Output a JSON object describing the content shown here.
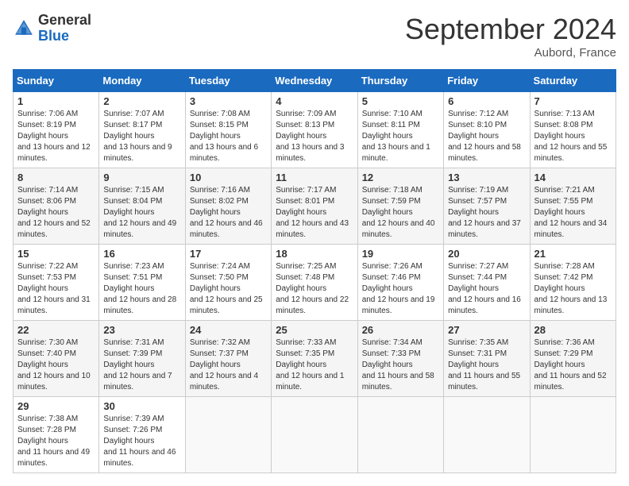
{
  "header": {
    "logo_general": "General",
    "logo_blue": "Blue",
    "month_title": "September 2024",
    "location": "Aubord, France"
  },
  "days_of_week": [
    "Sunday",
    "Monday",
    "Tuesday",
    "Wednesday",
    "Thursday",
    "Friday",
    "Saturday"
  ],
  "weeks": [
    [
      {
        "day": "1",
        "sunrise": "7:06 AM",
        "sunset": "8:19 PM",
        "daylight": "13 hours and 12 minutes."
      },
      {
        "day": "2",
        "sunrise": "7:07 AM",
        "sunset": "8:17 PM",
        "daylight": "13 hours and 9 minutes."
      },
      {
        "day": "3",
        "sunrise": "7:08 AM",
        "sunset": "8:15 PM",
        "daylight": "13 hours and 6 minutes."
      },
      {
        "day": "4",
        "sunrise": "7:09 AM",
        "sunset": "8:13 PM",
        "daylight": "13 hours and 3 minutes."
      },
      {
        "day": "5",
        "sunrise": "7:10 AM",
        "sunset": "8:11 PM",
        "daylight": "13 hours and 1 minute."
      },
      {
        "day": "6",
        "sunrise": "7:12 AM",
        "sunset": "8:10 PM",
        "daylight": "12 hours and 58 minutes."
      },
      {
        "day": "7",
        "sunrise": "7:13 AM",
        "sunset": "8:08 PM",
        "daylight": "12 hours and 55 minutes."
      }
    ],
    [
      {
        "day": "8",
        "sunrise": "7:14 AM",
        "sunset": "8:06 PM",
        "daylight": "12 hours and 52 minutes."
      },
      {
        "day": "9",
        "sunrise": "7:15 AM",
        "sunset": "8:04 PM",
        "daylight": "12 hours and 49 minutes."
      },
      {
        "day": "10",
        "sunrise": "7:16 AM",
        "sunset": "8:02 PM",
        "daylight": "12 hours and 46 minutes."
      },
      {
        "day": "11",
        "sunrise": "7:17 AM",
        "sunset": "8:01 PM",
        "daylight": "12 hours and 43 minutes."
      },
      {
        "day": "12",
        "sunrise": "7:18 AM",
        "sunset": "7:59 PM",
        "daylight": "12 hours and 40 minutes."
      },
      {
        "day": "13",
        "sunrise": "7:19 AM",
        "sunset": "7:57 PM",
        "daylight": "12 hours and 37 minutes."
      },
      {
        "day": "14",
        "sunrise": "7:21 AM",
        "sunset": "7:55 PM",
        "daylight": "12 hours and 34 minutes."
      }
    ],
    [
      {
        "day": "15",
        "sunrise": "7:22 AM",
        "sunset": "7:53 PM",
        "daylight": "12 hours and 31 minutes."
      },
      {
        "day": "16",
        "sunrise": "7:23 AM",
        "sunset": "7:51 PM",
        "daylight": "12 hours and 28 minutes."
      },
      {
        "day": "17",
        "sunrise": "7:24 AM",
        "sunset": "7:50 PM",
        "daylight": "12 hours and 25 minutes."
      },
      {
        "day": "18",
        "sunrise": "7:25 AM",
        "sunset": "7:48 PM",
        "daylight": "12 hours and 22 minutes."
      },
      {
        "day": "19",
        "sunrise": "7:26 AM",
        "sunset": "7:46 PM",
        "daylight": "12 hours and 19 minutes."
      },
      {
        "day": "20",
        "sunrise": "7:27 AM",
        "sunset": "7:44 PM",
        "daylight": "12 hours and 16 minutes."
      },
      {
        "day": "21",
        "sunrise": "7:28 AM",
        "sunset": "7:42 PM",
        "daylight": "12 hours and 13 minutes."
      }
    ],
    [
      {
        "day": "22",
        "sunrise": "7:30 AM",
        "sunset": "7:40 PM",
        "daylight": "12 hours and 10 minutes."
      },
      {
        "day": "23",
        "sunrise": "7:31 AM",
        "sunset": "7:39 PM",
        "daylight": "12 hours and 7 minutes."
      },
      {
        "day": "24",
        "sunrise": "7:32 AM",
        "sunset": "7:37 PM",
        "daylight": "12 hours and 4 minutes."
      },
      {
        "day": "25",
        "sunrise": "7:33 AM",
        "sunset": "7:35 PM",
        "daylight": "12 hours and 1 minute."
      },
      {
        "day": "26",
        "sunrise": "7:34 AM",
        "sunset": "7:33 PM",
        "daylight": "11 hours and 58 minutes."
      },
      {
        "day": "27",
        "sunrise": "7:35 AM",
        "sunset": "7:31 PM",
        "daylight": "11 hours and 55 minutes."
      },
      {
        "day": "28",
        "sunrise": "7:36 AM",
        "sunset": "7:29 PM",
        "daylight": "11 hours and 52 minutes."
      }
    ],
    [
      {
        "day": "29",
        "sunrise": "7:38 AM",
        "sunset": "7:28 PM",
        "daylight": "11 hours and 49 minutes."
      },
      {
        "day": "30",
        "sunrise": "7:39 AM",
        "sunset": "7:26 PM",
        "daylight": "11 hours and 46 minutes."
      },
      null,
      null,
      null,
      null,
      null
    ]
  ]
}
